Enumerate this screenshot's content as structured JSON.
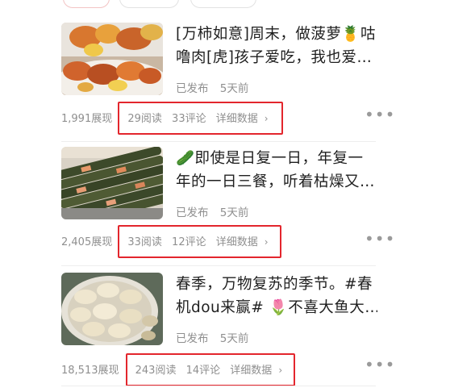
{
  "articles": [
    {
      "title_line1": "[万柿如意]周末，做菠萝🍍咕",
      "title_line2": "噜肉[虎]孩子爱吃，我也爱…",
      "status": "已发布",
      "time": "5天前",
      "impressions": "1,991展现",
      "reads": "29阅读",
      "comments": "33评论",
      "detail_label": "详细数据",
      "chevron": "›",
      "more": "•••",
      "thumb_icon": "sweet-sour-pork-photo"
    },
    {
      "title_line1": "🥒即使是日复一日，年复一",
      "title_line2": "年的一日三餐，听着枯燥又…",
      "status": "已发布",
      "time": "5天前",
      "impressions": "2,405展现",
      "reads": "33阅读",
      "comments": "12评论",
      "detail_label": "详细数据",
      "chevron": "›",
      "more": "•••",
      "thumb_icon": "seaweed-rolls-photo"
    },
    {
      "title_line1": "春季，万物复苏的季节。#春",
      "title_line2": "机dou来赢# 🌷不喜大鱼大…",
      "status": "已发布",
      "time": "5天前",
      "impressions": "18,513展现",
      "reads": "243阅读",
      "comments": "14评论",
      "detail_label": "详细数据",
      "chevron": "›",
      "more": "•••",
      "thumb_icon": "dumplings-photo"
    }
  ],
  "colors": {
    "highlight_box": "#e3262d",
    "meta_text": "#8f8f8f",
    "title_text": "#1f1f1f"
  }
}
